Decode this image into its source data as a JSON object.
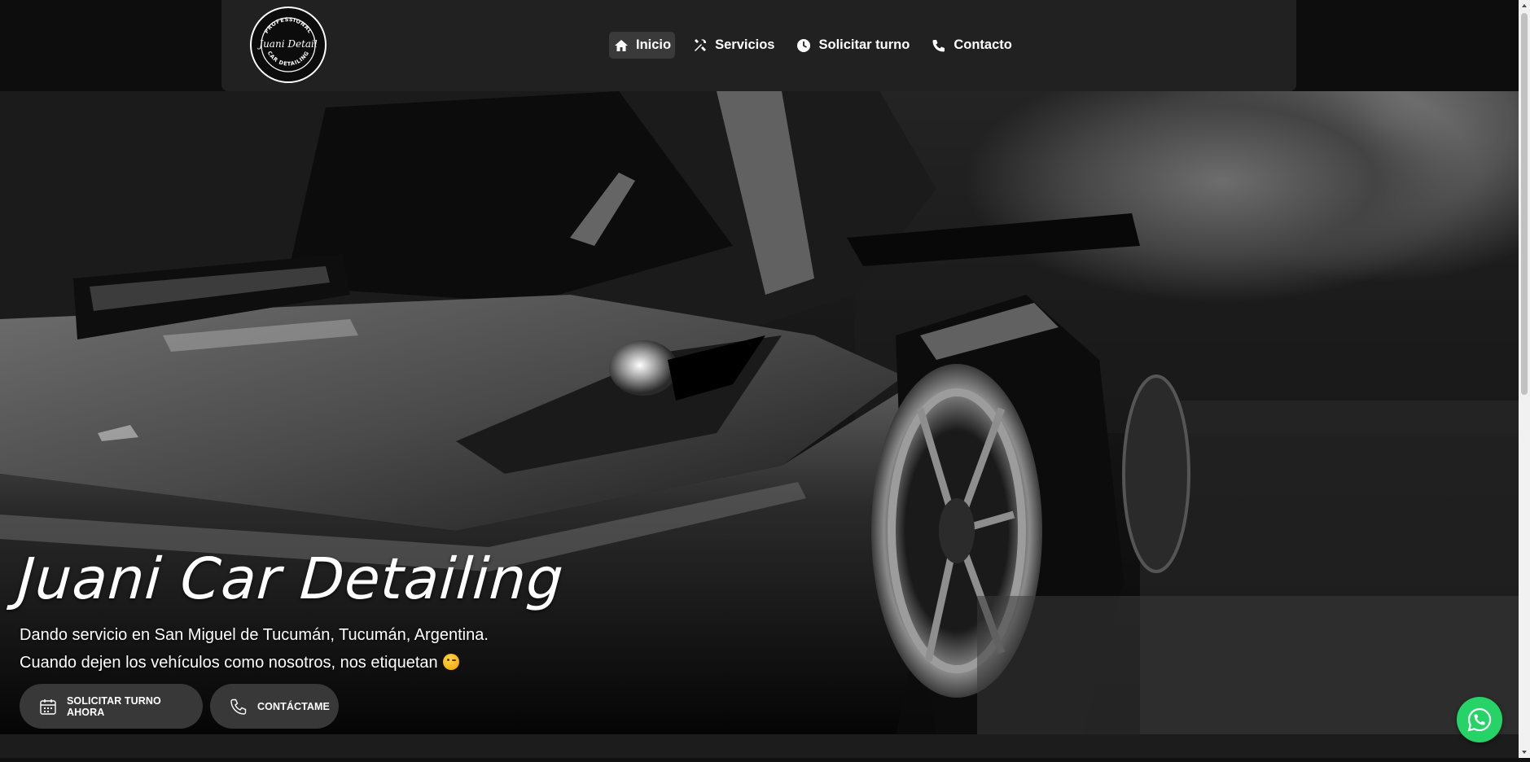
{
  "brand": {
    "logo_alt": "Juani Detail logo",
    "logo_top_text": "PROFESSIONAL",
    "logo_script": "Juani Detail",
    "logo_bottom_text": "CAR DETAILING"
  },
  "nav": {
    "items": [
      {
        "label": "Inicio",
        "icon": "home-icon",
        "active": true
      },
      {
        "label": "Servicios",
        "icon": "tools-icon",
        "active": false
      },
      {
        "label": "Solicitar turno",
        "icon": "clock-icon",
        "active": false
      },
      {
        "label": "Contacto",
        "icon": "phone-icon",
        "active": false
      }
    ]
  },
  "hero": {
    "title": "Juani Car Detailing",
    "line1": "Dando servicio en San Miguel de Tucumán, Tucumán, Argentina.",
    "line2": "Cuando dejen los vehículos como nosotros, nos etiquetan",
    "line2_emoji": "winking-face-emoji",
    "buttons": [
      {
        "label": "SOLICITAR TURNO AHORA",
        "icon": "calendar-icon"
      },
      {
        "label": "CONTÁCTAME",
        "icon": "phone-icon"
      }
    ]
  },
  "floating": {
    "icon": "whatsapp-icon"
  },
  "colors": {
    "navbar_bg": "#212121",
    "button_bg": "#383838",
    "whatsapp": "#25d366",
    "active_nav_bg": "#3a3a3a"
  }
}
